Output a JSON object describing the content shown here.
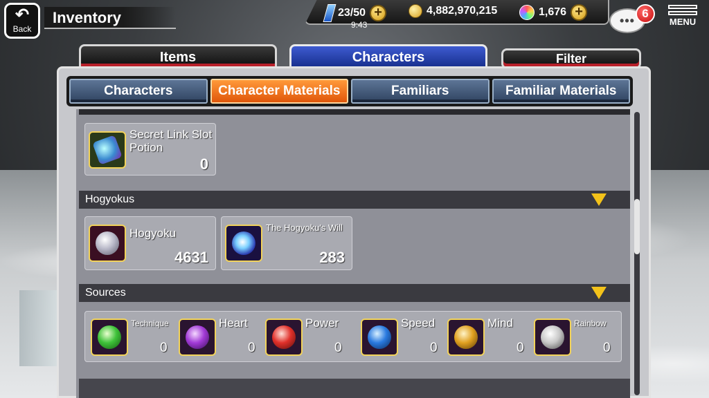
{
  "header": {
    "back_label": "Back",
    "title": "Inventory",
    "stamina": "23/50",
    "clock": "9:43",
    "coins": "4,882,970,215",
    "orbs": "1,676",
    "notifications": "6",
    "menu_label": "MENU"
  },
  "main_tabs": {
    "items": "Items",
    "characters": "Characters",
    "filter": "Filter"
  },
  "subtabs": [
    "Characters",
    "Character Materials",
    "Familiars",
    "Familiar Materials"
  ],
  "materials": {
    "secret_link": {
      "name": "Secret Link Slot Potion",
      "count": "0"
    },
    "hogyokus_header": "Hogyokus",
    "hogyoku": {
      "name": "Hogyoku",
      "count": "4631"
    },
    "hogyoku_will": {
      "name": "The Hogyoku's Will",
      "count": "283"
    },
    "sources_header": "Sources",
    "sources": [
      {
        "name": "Technique",
        "count": "0",
        "color": "#3fc23a"
      },
      {
        "name": "Heart",
        "count": "0",
        "color": "#a23ad6"
      },
      {
        "name": "Power",
        "count": "0",
        "color": "#e0302a"
      },
      {
        "name": "Speed",
        "count": "0",
        "color": "#2a7ae0"
      },
      {
        "name": "Mind",
        "count": "0",
        "color": "#e0a020"
      },
      {
        "name": "Rainbow",
        "count": "0",
        "color": "#e8e8e8"
      }
    ]
  }
}
